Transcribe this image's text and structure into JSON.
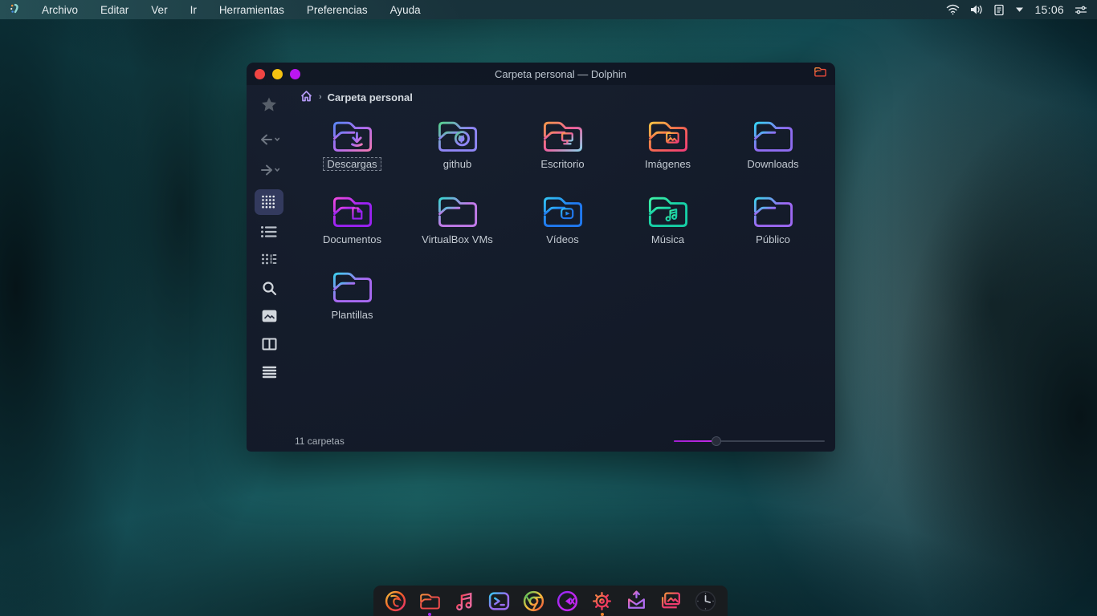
{
  "colors": {
    "accent_magenta": "#c32be8",
    "menubar_teal": "#23434c",
    "window_bg": "#141a2b",
    "sidebar_active_bg": "#333a5e",
    "traffic_close": "#f04543",
    "traffic_min": "#f5c211",
    "traffic_max": "#bb16f2",
    "label_text": "#c3cad2"
  },
  "menubar": {
    "logo": "distro-logo",
    "items": [
      "Archivo",
      "Editar",
      "Ver",
      "Ir",
      "Herramientas",
      "Preferencias",
      "Ayuda"
    ],
    "tray": {
      "icons": [
        "wifi",
        "volume",
        "clipboard",
        "caret-down",
        "tweaks"
      ],
      "time": "15:06"
    }
  },
  "window": {
    "title": "Carpeta personal — Dolphin",
    "app_icon": {
      "name": "folder-app-icon",
      "colors": [
        "#f5923d",
        "#ef4b3b"
      ]
    },
    "breadcrumb": {
      "root_icon": "home",
      "separator": "›",
      "path": "Carpeta personal"
    },
    "sidebar": {
      "tools": [
        "favorites",
        "back",
        "forward",
        "icons-view",
        "details-view",
        "compact-view",
        "search",
        "preview",
        "split-view",
        "menu"
      ],
      "active_tool": "icons-view"
    },
    "folders": [
      {
        "name": "Descargas",
        "glyph": "download-arrow",
        "colors": [
          "#5b86f5",
          "#b06cf0",
          "#f279b4"
        ],
        "selected": true
      },
      {
        "name": "github",
        "glyph": "github-octocat",
        "colors": [
          "#56d08e",
          "#8f86f5"
        ],
        "selected": false
      },
      {
        "name": "Escritorio",
        "glyph": "monitor",
        "colors": [
          "#f5964a",
          "#ef5f9e",
          "#8ed0ea"
        ],
        "selected": false
      },
      {
        "name": "Imágenes",
        "glyph": "image",
        "colors": [
          "#f7c244",
          "#f56a4e",
          "#f23d77"
        ],
        "selected": false
      },
      {
        "name": "Downloads",
        "glyph": "none",
        "colors": [
          "#35d4f5",
          "#8e6cf0"
        ],
        "selected": false
      },
      {
        "name": "Documentos",
        "glyph": "document",
        "colors": [
          "#f04ae0",
          "#9a22f2"
        ],
        "selected": false
      },
      {
        "name": "VirtualBox VMs",
        "glyph": "none",
        "colors": [
          "#38d6d0",
          "#c07ae8"
        ],
        "selected": false
      },
      {
        "name": "Vídeos",
        "glyph": "video-play",
        "colors": [
          "#33c4f5",
          "#2079f0"
        ],
        "selected": false
      },
      {
        "name": "Música",
        "glyph": "music-notes",
        "colors": [
          "#3df2a6",
          "#16cfa6"
        ],
        "selected": false
      },
      {
        "name": "Público",
        "glyph": "none",
        "colors": [
          "#3cd2ea",
          "#9c68f2"
        ],
        "selected": false
      },
      {
        "name": "Plantillas",
        "glyph": "none",
        "colors": [
          "#3ccfee",
          "#a86af2"
        ],
        "selected": false
      }
    ],
    "statusbar": {
      "text": "11 carpetas",
      "zoom_slider_fraction": 0.28
    }
  },
  "dock": {
    "items": [
      {
        "name": "firefox",
        "colors": [
          "#f5c13d",
          "#f0582a",
          "#e8326e"
        ],
        "indicator": null
      },
      {
        "name": "file-manager",
        "colors": [
          "#f5923d",
          "#ef4b4b"
        ],
        "indicator": "#a42bf0"
      },
      {
        "name": "music-player",
        "colors": [
          "#f03d4e",
          "#f06a9e"
        ],
        "indicator": null
      },
      {
        "name": "terminal",
        "colors": [
          "#35c9f0",
          "#9a6cf0"
        ],
        "indicator": null
      },
      {
        "name": "chromium",
        "colors": [
          "#4ac15e",
          "#f5c13d",
          "#ef4b3c"
        ],
        "indicator": null
      },
      {
        "name": "media-player",
        "colors": [
          "#8a2bf0",
          "#c026f0"
        ],
        "indicator": null
      },
      {
        "name": "settings",
        "colors": [
          "#f59a3d",
          "#ef3d5e"
        ],
        "indicator": "#f0822b"
      },
      {
        "name": "mail",
        "colors": [
          "#ef6aa8",
          "#b06cf0"
        ],
        "indicator": null
      },
      {
        "name": "gallery",
        "colors": [
          "#f5913d",
          "#ef3d6e"
        ],
        "indicator": null
      },
      {
        "name": "clock",
        "colors": [
          "#c9ced6",
          "#c9ced6"
        ],
        "indicator": null
      }
    ]
  }
}
